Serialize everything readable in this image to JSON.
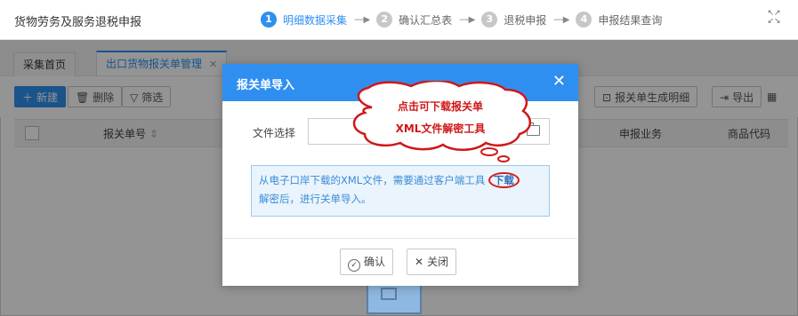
{
  "header": {
    "title": "货物劳务及服务退税申报",
    "steps": [
      {
        "num": "1",
        "label": "明细数据采集"
      },
      {
        "num": "2",
        "label": "确认汇总表"
      },
      {
        "num": "3",
        "label": "退税申报"
      },
      {
        "num": "4",
        "label": "申报结果查询"
      }
    ],
    "arrow": "----▶"
  },
  "tabs": [
    {
      "label": "采集首页"
    },
    {
      "label": "出口货物报关单管理"
    }
  ],
  "toolbar": {
    "new_label": "新建",
    "delete_label": "删除",
    "filter_label": "筛选",
    "generate_detail_label": "报关单生成明细",
    "export_label": "导出"
  },
  "table": {
    "columns": [
      "报关单号",
      "申报业务",
      "商品代码"
    ]
  },
  "modal": {
    "title": "报关单导入",
    "file_label": "文件选择",
    "info_text_1": "从电子口岸下载的XML文件，需要通过客户端工具",
    "download_link": "下载",
    "info_text_2": "解密后，进行关单导入。",
    "confirm_label": "确认",
    "close_label": "关闭"
  },
  "callout": {
    "line1": "点击可下载报关单",
    "line2": "XML文件解密工具"
  },
  "colors": {
    "primary": "#2f8ff0",
    "annotation": "#d01818"
  }
}
